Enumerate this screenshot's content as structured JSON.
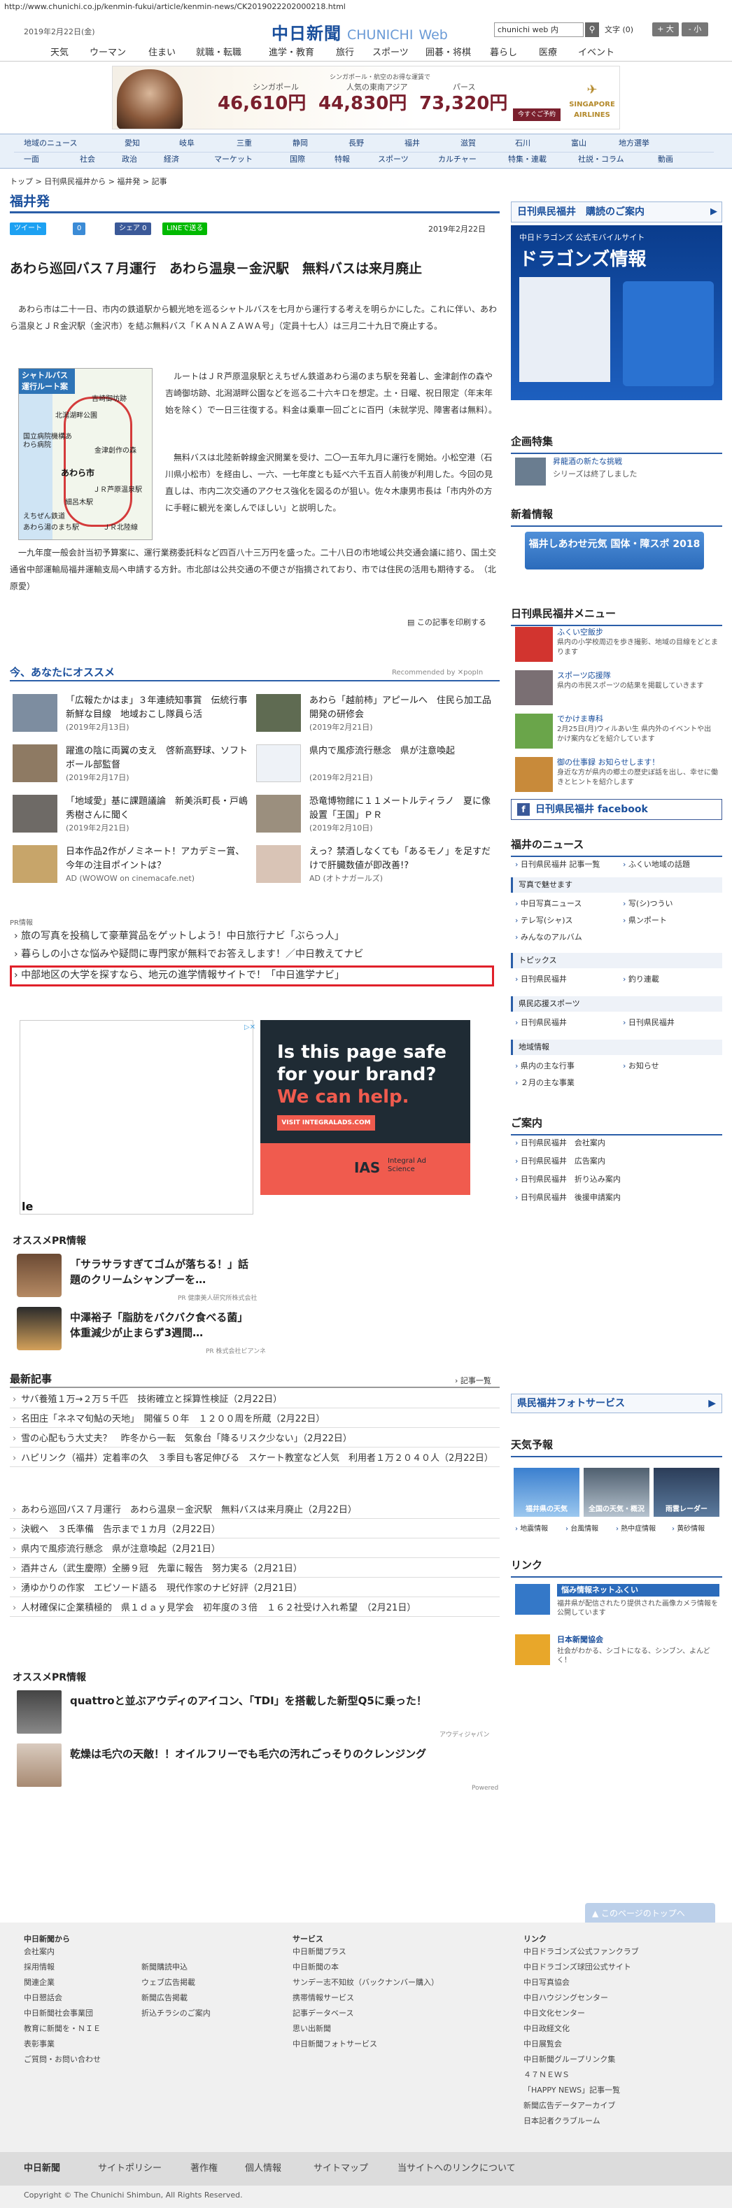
{
  "url": "http://www.chunichi.co.jp/kenmin-fukui/article/kenmin-news/CK2019022202000218.html",
  "header": {
    "date": "2019年2月22日(金)",
    "logo_ja": "中日新聞",
    "logo_en": "CHUNICHI",
    "logo_web": "Web",
    "search_placeholder": "chunichi web 内",
    "font_label": "文字",
    "font_size": "(0)",
    "font_larger": "+ 大",
    "font_smaller": "- 小"
  },
  "topnav": [
    "天気",
    "ウーマン",
    "住まい",
    "就職・転職",
    "進学・教育",
    "旅行",
    "スポーツ",
    "囲碁・将棋",
    "暮らし",
    "医療",
    "イベント"
  ],
  "ad": {
    "tagline": "シンガポール・航空のお得な運賃で",
    "routes": [
      "シンガポール",
      "人気の東南アジア",
      "パース"
    ],
    "prices": [
      "46,610円",
      "44,830円",
      "73,320円"
    ],
    "button": "今すぐご予約",
    "brand": "SINGAPORE AIRLINES"
  },
  "regnav": {
    "row1": [
      "地域のニュース",
      "愛知",
      "岐阜",
      "三重",
      "静岡",
      "長野",
      "福井",
      "滋賀",
      "石川",
      "富山",
      "地方選挙"
    ],
    "row2": [
      "一面",
      "社会",
      "政治",
      "経済",
      "マーケット",
      "国際",
      "特報",
      "スポーツ",
      "カルチャー",
      "特集・連載",
      "社説・コラム",
      "動画"
    ]
  },
  "breadcrumb": "トップ > 日刊県民福井から > 福井発 > 記事",
  "section_title": "福井発",
  "share": [
    "ツイート",
    "0",
    "シェア 0",
    "LINEで送る"
  ],
  "article": {
    "date": "2019年2月22日",
    "headline": "あわら巡回バス７月運行　あわら温泉－金沢駅　無料バスは来月廃止",
    "para1": "　あわら市は二十一日、市内の鉄道駅から観光地を巡るシャトルバスを七月から運行する考えを明らかにした。これに伴い、あわら温泉とＪＲ金沢駅（金沢市）を結ぶ無料バス「ＫＡＮＡＺＡＷＡ号」（定員十七人）は三月二十九日で廃止する。",
    "para2": "　ルートはＪＲ芦原温泉駅とえちぜん鉄道あわら湯のまち駅を発着し、金津創作の森や吉崎御坊跡、北潟湖畔公園などを巡る二十六キロを想定。土・日曜、祝日限定（年末年始を除く）で一日三往復する。料金は乗車一回ごとに百円（未就学児、障害者は無料）。",
    "para3": "　無料バスは北陸新幹線金沢開業を受け、二〇一五年九月に運行を開始。小松空港（石川県小松市）を経由し、一六、一七年度とも延べ六千五百人前後が利用した。今回の見直しは、市内二次交通のアクセス強化を図るのが狙い。佐々木康男市長は「市内外の方に手軽に観光を楽しんでほしい」と説明した。",
    "para4": "　一九年度一般会計当初予算案に、運行業務委託料など四百八十三万円を盛った。二十八日の市地域公共交通会議に諮り、国土交通省中部運輸局福井運輸支局へ申請する方針。市北部は公共交通の不便さが指摘されており、市では住民の活用も期待する。　（北原愛）",
    "print_link": "この記事を印刷する"
  },
  "map": {
    "title": "シャトルバス運行ルート案",
    "labels": [
      "吉崎御坊跡",
      "北潟湖畔公園",
      "国立病院機構あわら病院",
      "金津創作の森",
      "あわら市",
      "ＪＲ芦原温泉駅",
      "細呂木駅",
      "えちぜん鉄道",
      "あわら湯のまち駅",
      "ＪＲ北陸線"
    ],
    "city": "あわら市"
  },
  "recommend": {
    "title": "今、あなたにオススメ",
    "powered": "Recommended by ✕popIn",
    "items": [
      {
        "title": "「広報たかはま」３年連続知事賞　伝統行事新鮮な目線　地域おこし隊員ら活",
        "date": "(2019年2月13日)"
      },
      {
        "title": "あわら「越前柿」アピールへ　住民ら加工品開発の研修会",
        "date": "(2019年2月21日)"
      },
      {
        "title": "躍進の陰に両翼の支え　啓新高野球、ソフトボール部監督",
        "date": "(2019年2月17日)"
      },
      {
        "title": "県内で風疹流行懸念　県が注意喚起",
        "date": "(2019年2月21日)"
      },
      {
        "title": "「地域愛」基に課題議論　新美浜町長・戸嶋秀樹さんに聞く",
        "date": "(2019年2月21日)"
      },
      {
        "title": "恐竜博物館に１１メートルティラノ　夏に像設置「王国」ＰＲ",
        "date": "(2019年2月10日)"
      },
      {
        "title": "日本作品2作がノミネート！アカデミー賞、今年の注目ポイントは？",
        "date": "AD (WOWOW on cinemacafe.net)"
      },
      {
        "title": "えっ？禁酒しなくても「あるモノ」を足すだけで肝臓数値が即改善!?",
        "date": "AD (オトナガールズ)"
      }
    ]
  },
  "pr": {
    "label": "PR情報",
    "links": [
      "旅の写真を投稿して豪華賞品をゲットしよう！中日旅行ナビ「ぶらっ人」",
      "暮らしの小さな悩みや疑問に専門家が無料でお答えします！／中日教えてナビ",
      "中部地区の大学を探すなら、地元の進学情報サイトで！「中日進学ナビ」"
    ]
  },
  "ad3": {
    "line1": "Is this page safe",
    "line2": "for your brand?",
    "line3": "We can help.",
    "button": "VISIT INTEGRALADS.COM",
    "brand": "IAS",
    "brand2": "Integral Ad Science"
  },
  "ad2_mark": "le",
  "osusume_pr": {
    "title": "オススメPR情報",
    "items": [
      {
        "title": "「サラサラすぎてゴムが落ちる！」話題のクリームシャンプーを…",
        "sponsor": "PR  健康美人研究所株式会社"
      },
      {
        "title": "中澤裕子「脂肪をバクバク食べる菌」体重減少が止まらず3週間…",
        "sponsor": "PR  株式会社ビアンネ"
      }
    ]
  },
  "latest": {
    "title": "最新記事",
    "more": "記事一覧",
    "items": [
      "サバ養殖１万→２万５千匹　技術確立と採算性検証（2月22日）",
      "名田庄「ネネマ旬鮎の天地」　開催５０年　１２００周を所蔵（2月22日）",
      "雪の心配もう大丈夫？　昨冬から一転　気象台「降るリスク少ない」（2月22日）",
      "ハピリンク（福井）定着率の久　３季目も客足伸びる　スケート教室など人気　利用者１万２０４０人（2月22日）",
      "あわら巡回バス７月運行　あわら温泉－金沢駅　無料バスは来月廃止（2月22日）",
      "決戦へ　３氏準備　告示まで１カ月（2月22日）",
      "県内で風疹流行懸念　県が注意喚起（2月21日）",
      "酒井さん（武生慶際）全勝９冠　先輩に報告　努力実る（2月21日）",
      "湧ゆかりの作家　エピソード語る　現代作家のナビ好評（2月21日）",
      "人材確保に企業積極的　県１ｄａｙ見学会　初年度の３倍　１６２社受け入れ希望　（2月21日）"
    ]
  },
  "osusume_pr2": {
    "title": "オススメPR情報",
    "items": [
      {
        "title": "quattroと並ぶアウディのアイコン、「TDI」を搭載した新型Q5に乗った！",
        "sponsor": "アウディジャパン"
      },
      {
        "title": "乾燥は毛穴の天敵！！オイルフリーでも毛穴の汚れごっそりのクレンジング",
        "sponsor": ""
      }
    ],
    "ad_mark": "Powered"
  },
  "right": {
    "subscribe": "日刊県民福井　購読のご案内",
    "dragons": {
      "title": "中日ドラゴンズ 公式モバイルサイト",
      "big": "ドラゴンズ情報"
    },
    "kikaku": {
      "title": "企画特集",
      "item_title": "昇龍酒の新たな挑戦",
      "item_desc": "シリーズは終了しました"
    },
    "shinchaku": {
      "title": "新着情報",
      "banner": "福井しあわせ元気 国体・障スポ 2018"
    },
    "menu": {
      "title": "日刊県民福井メニュー",
      "items": [
        {
          "title": "ふくい空飯步",
          "desc": "県内の小学校周辺を歩き撮影、地域の目線をどとまります"
        },
        {
          "title": "スポーツ応援隊",
          "desc": "県内の市民スポーツの結果を掲載していきます"
        },
        {
          "title": "でかけま専科",
          "desc": "2月25日(月)ウィルあい生 県内外のイベントや出かけ案内などを紹介しています"
        },
        {
          "title": "御の仕事録 お知らせします！",
          "desc": "身近な方が県内の郷土の歴史ぼ話を出し、幸せに働きとヒントを紹介します"
        }
      ],
      "facebook": "日刊県民福井 facebook"
    },
    "fukui_news": {
      "title": "福井のニュース",
      "col1": [
        "日刊県民福井 記事一覧",
        "写真で魅せます",
        "中日写真ニュース",
        "テレ写(シャ)ス",
        "みんなのアルバム"
      ],
      "col2": [
        "ふくい地域の話題",
        "",
        "写(シ)つうい",
        "県ンポート",
        ""
      ]
    },
    "topics": {
      "title": "トピックス",
      "left": "日刊県民福井",
      "right": "釣り連載"
    },
    "sports": {
      "title": "県民応援スポーツ",
      "left": "日刊県民福井",
      "right": "日刊県民福井"
    },
    "chiiki": {
      "title": "地域情報",
      "left": "県内の主な行事",
      "right": "お知らせ",
      "extra": "２月の主な事業"
    },
    "guide": {
      "title": "ご案内",
      "items": [
        "日刊県民福井　会社案内",
        "日刊県民福井　広告案内",
        "日刊県民福井　折り込み案内",
        "日刊県民福井　後援申請案内"
      ]
    },
    "photo_service": "県民福井フォトサービス",
    "weather": {
      "title": "天気予報",
      "items": [
        "福井県の天気",
        "全国の天気・概況",
        "雨雲レーダー"
      ],
      "sub": [
        "地震情報",
        "台風情報",
        "熱中症情報",
        "黄砂情報"
      ]
    },
    "links": {
      "title": "リンク",
      "items": [
        {
          "title": "悩み情報ネットふくい",
          "desc": "福井県が配信されたり提供された画像カメラ情報を公開しています"
        },
        {
          "title": "日本新聞協会",
          "desc": "社会がわかる、シゴトになる、シンブン、よんどく！"
        }
      ]
    }
  },
  "pagetop": "このページのトップへ",
  "footer": {
    "col1": {
      "title": "中日新聞から",
      "items": [
        "会社案内",
        "採用情報",
        "関連企業",
        "中日懇話会",
        "中日新聞社会事業団",
        "教育に新聞を・ＮＩＥ",
        "表彰事業",
        "ご質問・お問い合わせ"
      ]
    },
    "col2": {
      "title": "",
      "items": [
        "新聞購読申込",
        "ウェブ広告掲載",
        "新聞広告掲載",
        "折込チラシのご案内"
      ]
    },
    "col3": {
      "title": "サービス",
      "items": [
        "中日新聞プラス",
        "中日新聞の本",
        "サンデー志不知紋（バックナンバー購入）",
        "携帯情報サービス",
        "記事データベース",
        "思い出新聞",
        "中日新聞フォトサービス"
      ]
    },
    "col4": {
      "title": "リンク",
      "items": [
        "中日ドラゴンズ公式ファンクラブ",
        "中日ドラゴンズ球団公式サイト",
        "中日写真協会",
        "中日ハウジングセンター",
        "中日文化センター",
        "中日政経文化",
        "中日展覧会",
        "中日新聞グループリンク集",
        "４７ＮＥＷＳ",
        "「HAPPY NEWS」記事一覧",
        "新聞広告データアーカイブ",
        "日本記者クラブルーム"
      ]
    },
    "bar": [
      "中日新聞",
      "サイトポリシー",
      "著作権",
      "個人情報",
      "サイトマップ",
      "当サイトへのリンクについて"
    ],
    "copyright": "Copyright © The Chunichi Shimbun, All Rights Reserved."
  },
  "colors": {
    "brand": "#1a4f9c",
    "accent_red": "#e0202a",
    "nav_bg": "#e8f0f9"
  }
}
